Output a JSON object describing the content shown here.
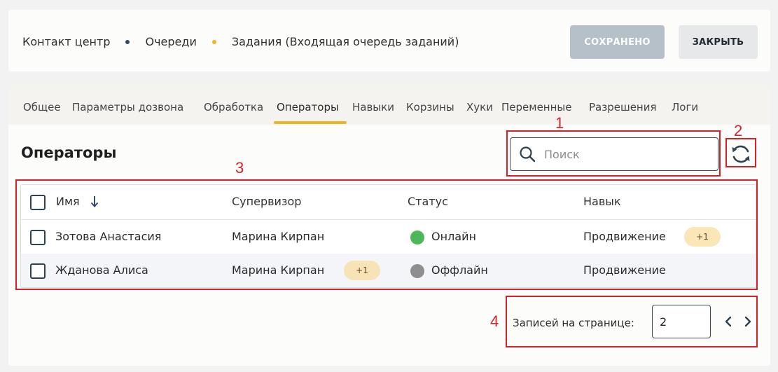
{
  "breadcrumbs": [
    {
      "label": "Контакт центр",
      "dot_color": "#2f4a60"
    },
    {
      "label": "Очереди",
      "dot_color": "#f2b320"
    },
    {
      "label": "Задания (Входящая очередь заданий)"
    }
  ],
  "header": {
    "saved_label": "СОХРАНЕНО",
    "close_label": "ЗАКРЫТЬ"
  },
  "tabs": [
    "Общее",
    "Параметры дозвона",
    "Обработка",
    "Операторы",
    "Навыки",
    "Корзины",
    "Хуки",
    "Переменные",
    "Разрешения",
    "Логи"
  ],
  "active_tab": "Операторы",
  "section_title": "Операторы",
  "search": {
    "placeholder": "Поиск",
    "value": "",
    "icon": "search-icon"
  },
  "refresh_icon": "refresh-icon",
  "table": {
    "columns": [
      "Имя",
      "Супервизор",
      "Статус",
      "Навык"
    ],
    "sort_icon": "arrow-down-icon",
    "rows": [
      {
        "name": "Зотова Анастасия",
        "supervisor": "Марина Кирпан",
        "supervisor_extra": "",
        "status": "Онлайн",
        "status_color": "#4db85a",
        "skill": "Продвижение",
        "skill_extra": "+1"
      },
      {
        "name": "Жданова Алиса",
        "supervisor": "Марина Кирпан",
        "supervisor_extra": "+1",
        "status": "Оффлайн",
        "status_color": "#8e8e8e",
        "skill": "Продвижение",
        "skill_extra": ""
      }
    ]
  },
  "pagination": {
    "label": "Записей на странице:",
    "value": "2"
  },
  "annotations": [
    "1",
    "2",
    "3",
    "4"
  ],
  "colors": {
    "accent": "#f2b320",
    "annotation": "#d6202a",
    "primary_dark": "#2f4250"
  }
}
